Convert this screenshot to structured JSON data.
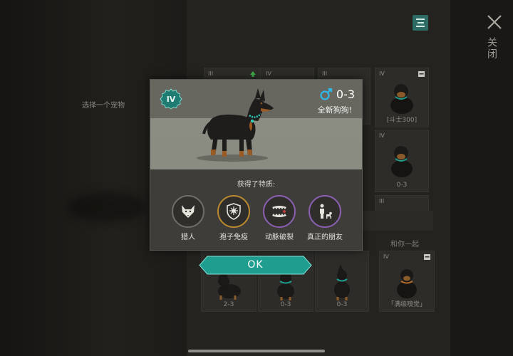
{
  "background": {
    "select_pet_text": "选择一个宠物",
    "close_label": "关闭",
    "section_labels": [
      "和你一起"
    ],
    "grid_cards": [
      {
        "tier": "III",
        "caption": ""
      },
      {
        "tier": "IV",
        "caption": ""
      },
      {
        "tier": "III",
        "caption": ""
      },
      {
        "tier": "IV",
        "caption": "[斗士300]"
      },
      {
        "tier": "IV",
        "caption": "0-3"
      },
      {
        "tier": "III",
        "caption": ""
      },
      {
        "tier": "",
        "caption": "2-3"
      },
      {
        "tier": "",
        "caption": "0-3"
      },
      {
        "tier": "",
        "caption": "0-3"
      },
      {
        "tier": "IV",
        "caption": "「满级嗅觉」"
      }
    ]
  },
  "modal": {
    "tier": "IV",
    "age": "0-3",
    "status": "全新狗狗!",
    "traits_title": "获得了特质:",
    "traits": [
      {
        "label": "猎人",
        "icon": "fox-icon",
        "ring_color": "#6e6d6a"
      },
      {
        "label": "孢子免疫",
        "icon": "spore-shield-icon",
        "ring_color": "#b8892e"
      },
      {
        "label": "动脉破裂",
        "icon": "jaw-bite-icon",
        "ring_color": "#8a5fb0"
      },
      {
        "label": "真正的朋友",
        "icon": "person-dog-icon",
        "ring_color": "#8a5fb0"
      }
    ],
    "ok_label": "OK"
  },
  "colors": {
    "accent_teal": "#1f9e90",
    "gold": "#b8892e",
    "purple": "#8a5fb0"
  }
}
